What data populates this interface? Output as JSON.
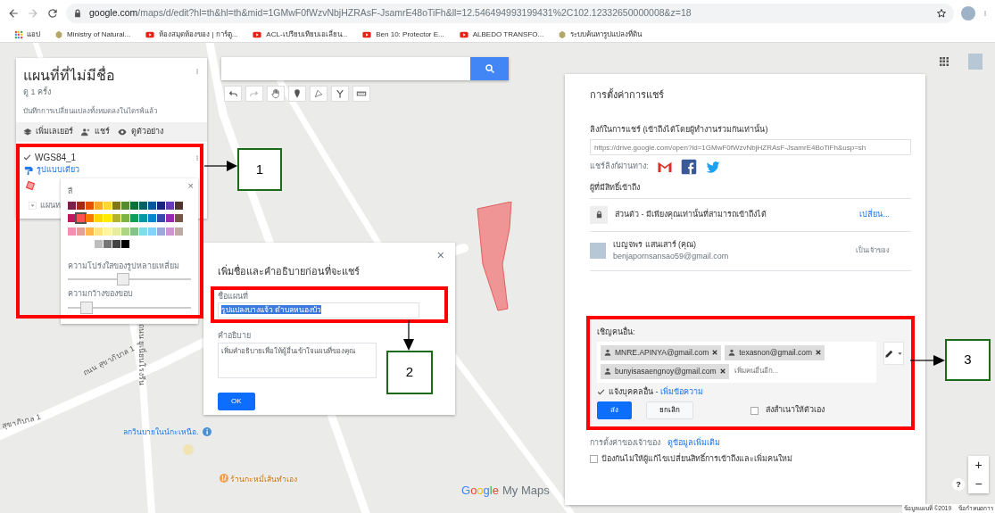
{
  "browser": {
    "url_host": "google.com",
    "url_path": "/maps/d/edit?hl=th&hl=th&mid=1GMwF0fWzvNbjHZRAsF-JsamrE48oTiFh&ll=12.546494993199431%2C102.12332650000008&z=18",
    "bookmarks": [
      {
        "label": "แอป",
        "kind": "apps"
      },
      {
        "label": "Ministry of Natural...",
        "kind": "emblem"
      },
      {
        "label": "ห้องสมุดห้องของ | การ์ตู...",
        "kind": "video"
      },
      {
        "label": "ACL-เปรียบเทียบเอเลี่ยน...",
        "kind": "video"
      },
      {
        "label": "Ben 10: Protector E...",
        "kind": "video"
      },
      {
        "label": "ALBEDO TRANSFO...",
        "kind": "video"
      },
      {
        "label": "ระบบค้นหารูปแปลงที่ดิน",
        "kind": "emblem"
      }
    ]
  },
  "map_panel": {
    "title": "แผนที่ที่ไม่มีชื่อ",
    "views": "ดู 1 ครั้ง",
    "saved_status": "บันทึกการเปลี่ยนแปลงทั้งหมดลงในไดรฟ์แล้ว",
    "actions": [
      {
        "label": "เพิ่มเลเยอร์",
        "kind": "layer"
      },
      {
        "label": "แชร์",
        "kind": "share"
      },
      {
        "label": "ดูตัวอย่าง",
        "kind": "preview"
      }
    ],
    "layer": {
      "name": "WGS84_1",
      "checked": true,
      "style_link": "รูปแบบเดียว"
    },
    "base_map": "แผนท"
  },
  "style_popup": {
    "color_label": "สี",
    "palette": [
      {
        "color": "#7b1f4b",
        "selected": false
      },
      {
        "color": "#a52714",
        "selected": false
      },
      {
        "color": "#e65100",
        "selected": false
      },
      {
        "color": "#f9a825",
        "selected": false
      },
      {
        "color": "#fdd835",
        "selected": false
      },
      {
        "color": "#817717",
        "selected": false
      },
      {
        "color": "#558b2f",
        "selected": false
      },
      {
        "color": "#097138",
        "selected": false
      },
      {
        "color": "#006064",
        "selected": false
      },
      {
        "color": "#01579b",
        "selected": false
      },
      {
        "color": "#1a237e",
        "selected": false
      },
      {
        "color": "#673ab7",
        "selected": false
      },
      {
        "color": "#4e342e",
        "selected": false
      },
      {
        "color": "#c2185b",
        "selected": false
      },
      {
        "color": "#ff5252",
        "selected": true
      },
      {
        "color": "#f57c00",
        "selected": false
      },
      {
        "color": "#ffd600",
        "selected": false
      },
      {
        "color": "#ffea00",
        "selected": false
      },
      {
        "color": "#afb42b",
        "selected": false
      },
      {
        "color": "#7cb342",
        "selected": false
      },
      {
        "color": "#0f9d58",
        "selected": false
      },
      {
        "color": "#0097a7",
        "selected": false
      },
      {
        "color": "#0288d1",
        "selected": false
      },
      {
        "color": "#3949ab",
        "selected": false
      },
      {
        "color": "#9c27b0",
        "selected": false
      },
      {
        "color": "#795548",
        "selected": false
      },
      {
        "color": "#f48fb1",
        "selected": false
      },
      {
        "color": "#e6a09a",
        "selected": false
      },
      {
        "color": "#ffb74d",
        "selected": false
      },
      {
        "color": "#ffe57f",
        "selected": false
      },
      {
        "color": "#fff59d",
        "selected": false
      },
      {
        "color": "#e6ee9c",
        "selected": false
      },
      {
        "color": "#aed581",
        "selected": false
      },
      {
        "color": "#81c784",
        "selected": false
      },
      {
        "color": "#80deea",
        "selected": false
      },
      {
        "color": "#81d4fa",
        "selected": false
      },
      {
        "color": "#9fa8da",
        "selected": false
      },
      {
        "color": "#ce93d8",
        "selected": false
      },
      {
        "color": "#bcaaa4",
        "selected": false
      },
      {
        "color": "#bdbdbd",
        "selected": false
      },
      {
        "color": "#757575",
        "selected": false
      },
      {
        "color": "#424242",
        "selected": false
      },
      {
        "color": "#000000",
        "selected": false
      }
    ],
    "opacity_label": "ความโปร่งใสของรูปหลายเหลี่ยม",
    "opacity": {
      "level": 0.45
    },
    "border_label": "ความกว้างของขอบ",
    "border": {
      "level": 0.15
    }
  },
  "name_dialog": {
    "title": "เพิ่มชื่อและคำอธิบายก่อนที่จะแชร์",
    "name_label": "ชื่อแผนที่",
    "name_value": "รูปแปลงบางแจ้ว ตำบลหนองบัว",
    "description_label": "คำอธิบาย",
    "description_placeholder": "เพิ่มคำอธิบายเพื่อให้ผู้อื่นเข้าใจแผนที่ของคุณ",
    "ok": "OK",
    "close": "×"
  },
  "sharing": {
    "title": "การตั้งค่าการแชร์",
    "link_label": "ลิงก์ในการแชร์ (เข้าถึงได้โดยผู้ทำงานร่วมกันเท่านั้น)",
    "link": "https://drive.google.com/open?id=1GMwF0fWzvNbjHZRAsF-JsamrE4BoTiFh&usp=sh",
    "share_via": "แชร์ลิงก์ผ่านทาง:",
    "access_label": "ผู้ที่มีสิทธิ์เข้าถึง",
    "access": {
      "text": "ส่วนตัว - มีเพียงคุณเท่านั้นที่สามารถเข้าถึงได้",
      "change": "เปลี่ยน..."
    },
    "owner": {
      "name": "เบญจพร แสนเสาร์ (คุณ)",
      "email": "benjapornsansao59@gmail.com",
      "role": "เป็นเจ้าของ"
    },
    "invite_label": "เชิญคนอื่น:",
    "invitees": [
      "MNRE.APINYA@gmail.com",
      "texasnon@gmail.com",
      "bunyisasaengnoy@gmail.com"
    ],
    "invite_placeholder": "เพิ่มคนอื่นอีก...",
    "notify": {
      "label": "แจ้งบุคคลอื่น - ",
      "link": "เพิ่มข้อความ",
      "checked": true
    },
    "send": "ส่ง",
    "cancel": "ยกเลิก",
    "send_copy": {
      "label": "ส่งสำเนาให้ตัวเอง",
      "checked": false
    },
    "owner_settings": "การตั้งค่าของเจ้าของ",
    "learn_more": "ดูข้อมูลเพิ่มเติม",
    "prevent": {
      "label": "ป้องกันไม่ให้ผู้แก้ไขเปลี่ยนสิทธิ์การเข้าถึงและเพิ่มคนใหม่",
      "checked": false
    }
  },
  "map_labels": [
    {
      "text": "ถนน ยูเนี่ยนโรงรีน",
      "kind": "vertical"
    },
    {
      "text": "ถนน สุขาภิบาล 1",
      "kind": "road"
    },
    {
      "text": "สุขาภิบาล 1",
      "kind": "road2"
    },
    {
      "text": "ลกวินบายในน์กะเหนือ.",
      "kind": "poi"
    },
    {
      "text": "ร้านกะหมี่เส้นทำเอง",
      "kind": "food"
    }
  ],
  "logo": {
    "brand": "Google",
    "product": "My Maps"
  },
  "attribution": [
    "ข้อมูลแผนที่ ©2019",
    "ข้อกำหนดการ"
  ],
  "zoom": {
    "in": "+",
    "out": "−",
    "help": "?"
  },
  "annotations": [
    "1",
    "2",
    "3"
  ]
}
